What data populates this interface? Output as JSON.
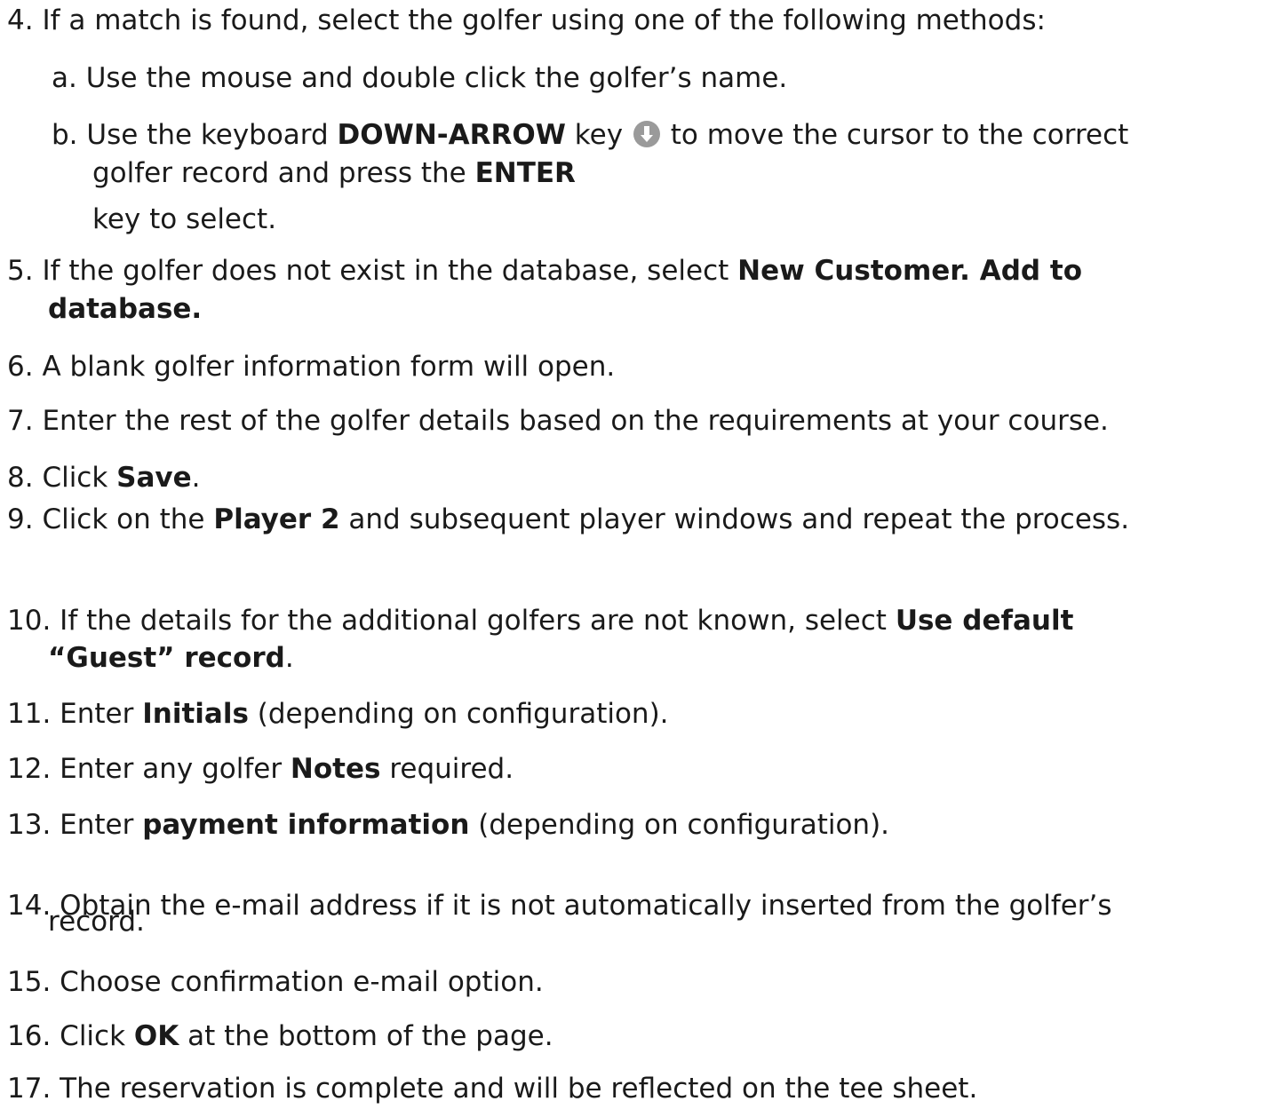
{
  "steps": {
    "s4": {
      "num": "4.",
      "text": "If a match is found, select the golfer using one of the following methods:"
    },
    "s4a": {
      "num": "a.",
      "text": "Use the mouse and double click the golfer’s name."
    },
    "s4b": {
      "num": "b.",
      "t1": "Use the keyboard ",
      "b1": "DOWN-ARROW",
      "t2": " key ",
      "icon": "down-arrow-key-icon",
      "t3": " to move the cursor to the correct",
      "line2a": "golfer record and press the ",
      "b2": "ENTER",
      "line3": "key to select."
    },
    "s5": {
      "num": "5.",
      "t1": "If the golfer does not exist in the database, select ",
      "b1": "New Customer. Add to",
      "b2": "database."
    },
    "s6": {
      "num": "6.",
      "text": "A blank golfer information form will open."
    },
    "s7": {
      "num": "7.",
      "text": "Enter the rest of the golfer details based on the requirements at your course."
    },
    "s8": {
      "num": "8.",
      "t1": "Click ",
      "b1": "Save",
      "t2": "."
    },
    "s9": {
      "num": "9.",
      "t1": "Click on the ",
      "b1": "Player 2",
      "t2": " and subsequent player windows and repeat the process."
    },
    "s10": {
      "num": "10.",
      "t1": "If the details for the additional golfers are not known, select ",
      "b1": "Use default",
      "b2": "“Guest” record",
      "t2": "."
    },
    "s11": {
      "num": "11.",
      "t1": "Enter ",
      "b1": "Initials",
      "t2": " (depending on configuration)."
    },
    "s12": {
      "num": "12.",
      "t1": "Enter any golfer ",
      "b1": "Notes",
      "t2": " required."
    },
    "s13": {
      "num": "13.",
      "t1": "Enter ",
      "b1": "payment information",
      "t2": " (depending on configuration)."
    },
    "s14": {
      "num": "14.",
      "t1": "Obtain the e-mail address if it is not automatically inserted from the golfer’s",
      "t2": "record."
    },
    "s15": {
      "num": "15.",
      "text": "Choose confirmation e-mail option."
    },
    "s16": {
      "num": "16.",
      "t1": "Click ",
      "b1": "OK",
      "t2": " at the bottom of the page."
    },
    "s17": {
      "num": "17.",
      "text": "The reservation is complete and will be reflected on the tee sheet."
    }
  },
  "colors": {
    "text": "#1a1a1a",
    "icon": "#9a9a9a",
    "background": "#ffffff"
  }
}
